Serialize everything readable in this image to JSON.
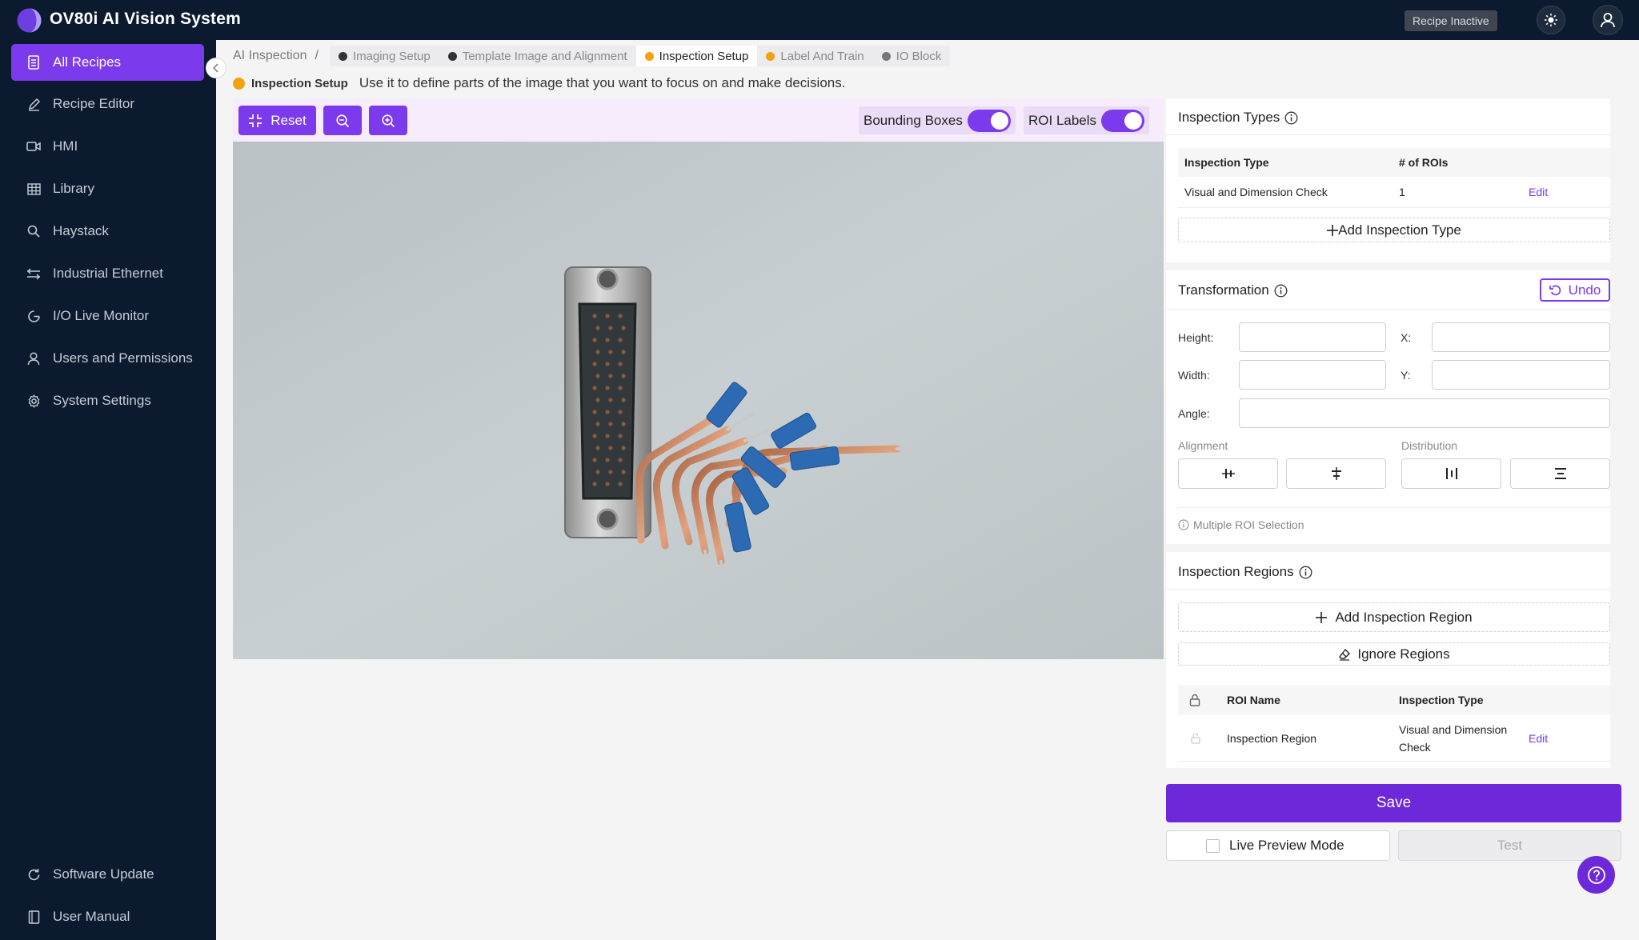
{
  "app": {
    "title": "OV80i AI Vision System",
    "recipe_status": "Recipe Inactive"
  },
  "sidebar": {
    "items": [
      {
        "label": "All Recipes",
        "icon": "document-icon",
        "active": true
      },
      {
        "label": "Recipe Editor",
        "icon": "pencil-icon"
      },
      {
        "label": "HMI",
        "icon": "video-icon"
      },
      {
        "label": "Library",
        "icon": "table-icon"
      },
      {
        "label": "Haystack",
        "icon": "search-icon"
      },
      {
        "label": "Industrial Ethernet",
        "icon": "ethernet-icon"
      },
      {
        "label": "I/O Live Monitor",
        "icon": "monitor-icon"
      },
      {
        "label": "Users and Permissions",
        "icon": "user-icon"
      },
      {
        "label": "System Settings",
        "icon": "gear-icon"
      }
    ],
    "bottom": [
      {
        "label": "Software Update",
        "icon": "refresh-icon"
      },
      {
        "label": "User Manual",
        "icon": "book-icon"
      }
    ]
  },
  "breadcrumb": {
    "root": "AI Inspection",
    "separator": "/",
    "steps": [
      {
        "label": "Imaging Setup",
        "color": "#333333"
      },
      {
        "label": "Template Image and Alignment",
        "color": "#333333"
      },
      {
        "label": "Inspection Setup",
        "color": "#f5a20a",
        "current": true
      },
      {
        "label": "Label And Train",
        "color": "#f5a20a"
      },
      {
        "label": "IO Block",
        "color": "#777777"
      }
    ]
  },
  "header": {
    "step": "Inspection Setup",
    "description": "Use it to define parts of the image that you want to focus on and make decisions."
  },
  "toolbar": {
    "reset": "Reset",
    "bounding_boxes": "Bounding Boxes",
    "roi_labels": "ROI Labels",
    "bounding_boxes_on": true,
    "roi_labels_on": true
  },
  "inspection_types": {
    "title": "Inspection Types",
    "columns": [
      "Inspection Type",
      "# of ROIs"
    ],
    "rows": [
      {
        "type": "Visual and Dimension Check",
        "rois": "1",
        "action": "Edit"
      }
    ],
    "add_label": "Add Inspection Type"
  },
  "transformation": {
    "title": "Transformation",
    "undo": "Undo",
    "height_label": "Height:",
    "x_label": "X:",
    "width_label": "Width:",
    "y_label": "Y:",
    "angle_label": "Angle:",
    "height_value": "",
    "x_value": "",
    "width_value": "",
    "y_value": "",
    "angle_value": "",
    "alignment_label": "Alignment",
    "distribution_label": "Distribution",
    "multi_roi_note": "Multiple ROI Selection"
  },
  "inspection_regions": {
    "title": "Inspection Regions",
    "add_label": "Add Inspection Region",
    "ignore_label": "Ignore Regions",
    "columns": [
      "ROI Name",
      "Inspection Type"
    ],
    "rows": [
      {
        "name": "Inspection Region",
        "type_line1": "Visual and Dimension",
        "type_line2": "Check",
        "action": "Edit"
      }
    ]
  },
  "footer": {
    "save": "Save",
    "live_preview": "Live Preview Mode",
    "test": "Test"
  },
  "colors": {
    "accent": "#7c3aed",
    "nav_bg": "#0b1a2e",
    "status_orange": "#f5a20a"
  }
}
